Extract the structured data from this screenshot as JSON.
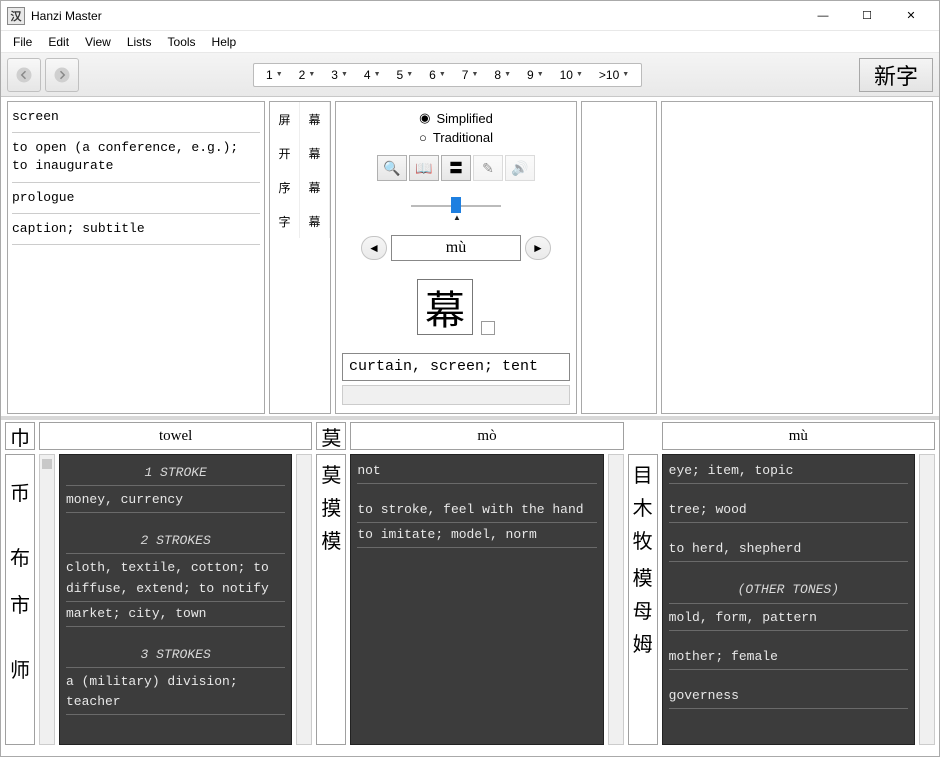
{
  "window": {
    "title": "Hanzi Master",
    "icon_label": "汉"
  },
  "menu": [
    "File",
    "Edit",
    "View",
    "Lists",
    "Tools",
    "Help"
  ],
  "toolbar": {
    "numbers": [
      "1",
      "2",
      "3",
      "4",
      "5",
      "6",
      "7",
      "8",
      "9",
      "10",
      ">10"
    ],
    "new_char_label": "新字"
  },
  "definitions": [
    "screen",
    "to open (a conference, e.g.); to inaugurate",
    "prologue",
    "caption; subtitle"
  ],
  "compounds": [
    [
      "屏",
      "幕"
    ],
    [
      "开",
      "幕"
    ],
    [
      "序",
      "幕"
    ],
    [
      "字",
      "幕"
    ]
  ],
  "center": {
    "script_simplified": "Simplified",
    "script_traditional": "Traditional",
    "pinyin": "mù",
    "hanzi": "幕",
    "definition": "curtain, screen; tent"
  },
  "lower": [
    {
      "radical": "巾",
      "header": "towel",
      "chars": [
        "",
        "币",
        "",
        "布",
        "市",
        "",
        "师"
      ],
      "entries": [
        {
          "type": "hdr",
          "text": "1 STROKE"
        },
        {
          "type": "entry",
          "text": "money, currency"
        },
        {
          "type": "gap",
          "text": ""
        },
        {
          "type": "hdr",
          "text": "2 STROKES"
        },
        {
          "type": "entry",
          "text": "cloth, textile, cotton; to diffuse, extend; to notify"
        },
        {
          "type": "entry",
          "text": "market; city, town"
        },
        {
          "type": "gap",
          "text": ""
        },
        {
          "type": "hdr",
          "text": "3 STROKES"
        },
        {
          "type": "entry",
          "text": "a (military) division; teacher"
        }
      ]
    },
    {
      "radical": "莫",
      "header": "mò",
      "chars": [
        "莫",
        "摸",
        "模"
      ],
      "entries": [
        {
          "type": "entry",
          "text": "not"
        },
        {
          "type": "gap",
          "text": ""
        },
        {
          "type": "entry",
          "text": "to stroke, feel with the hand"
        },
        {
          "type": "entry",
          "text": "to imitate; model, norm"
        }
      ]
    },
    {
      "radical": "",
      "header": "mù",
      "chars": [
        "目",
        "木",
        "牧",
        "",
        "模",
        "母",
        "姆"
      ],
      "entries": [
        {
          "type": "entry",
          "text": "eye; item, topic"
        },
        {
          "type": "gap",
          "text": ""
        },
        {
          "type": "entry",
          "text": "tree; wood"
        },
        {
          "type": "gap",
          "text": ""
        },
        {
          "type": "entry",
          "text": "to herd, shepherd"
        },
        {
          "type": "gap",
          "text": ""
        },
        {
          "type": "hdr",
          "text": "(OTHER TONES)"
        },
        {
          "type": "entry",
          "text": "mold, form, pattern"
        },
        {
          "type": "gap",
          "text": ""
        },
        {
          "type": "entry",
          "text": "mother; female"
        },
        {
          "type": "gap",
          "text": ""
        },
        {
          "type": "entry",
          "text": "governess"
        }
      ]
    }
  ]
}
